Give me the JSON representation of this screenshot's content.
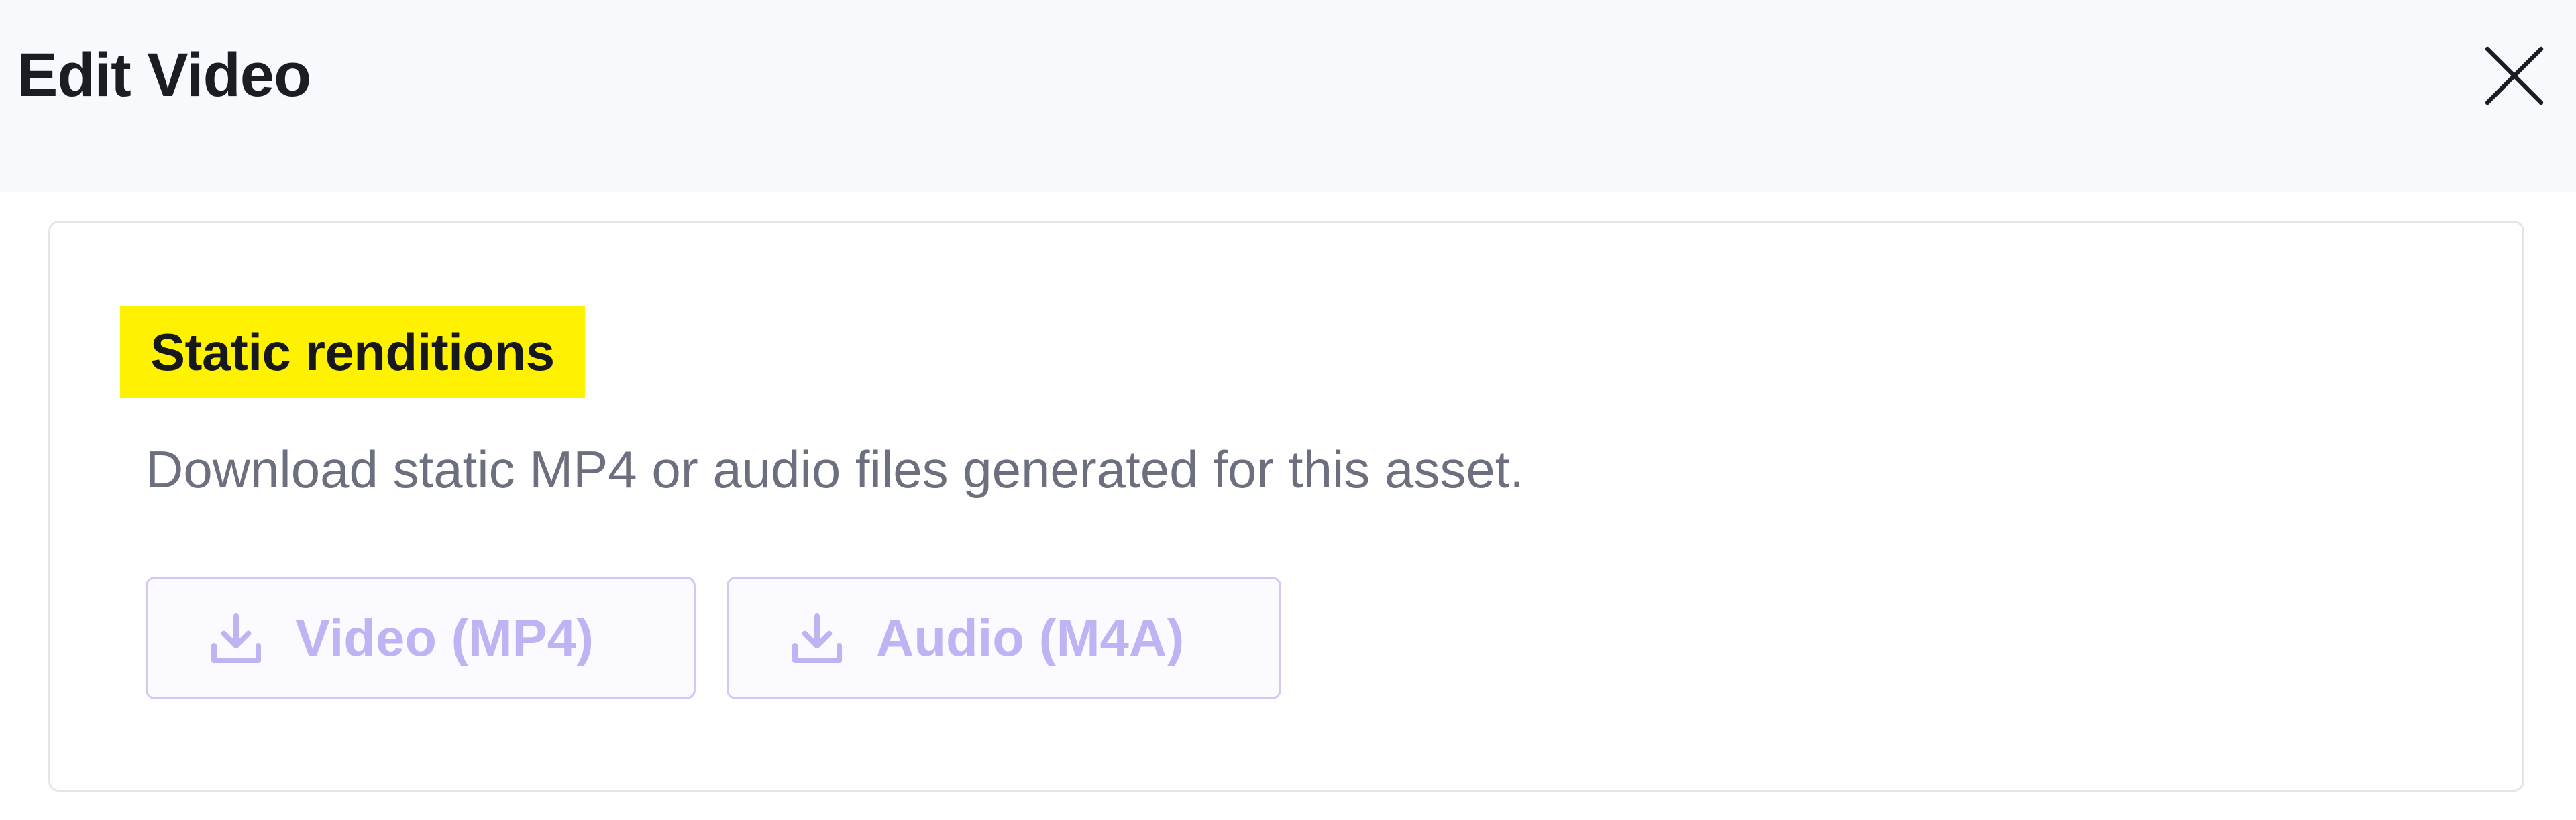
{
  "modal": {
    "title": "Edit Video",
    "close_icon": "close-icon"
  },
  "static_renditions": {
    "heading": "Static renditions",
    "description": "Download static MP4 or audio files generated for this asset.",
    "buttons": [
      {
        "label": "Video (MP4)",
        "icon": "download-icon",
        "state": "disabled"
      },
      {
        "label": "Audio (M4A)",
        "icon": "download-icon",
        "state": "disabled"
      }
    ]
  },
  "colors": {
    "header_background": "#f8f9fc",
    "heading_highlight": "#fff200",
    "button_text_disabled": "#bdb4f4",
    "button_border_disabled": "#cfc9f7"
  }
}
